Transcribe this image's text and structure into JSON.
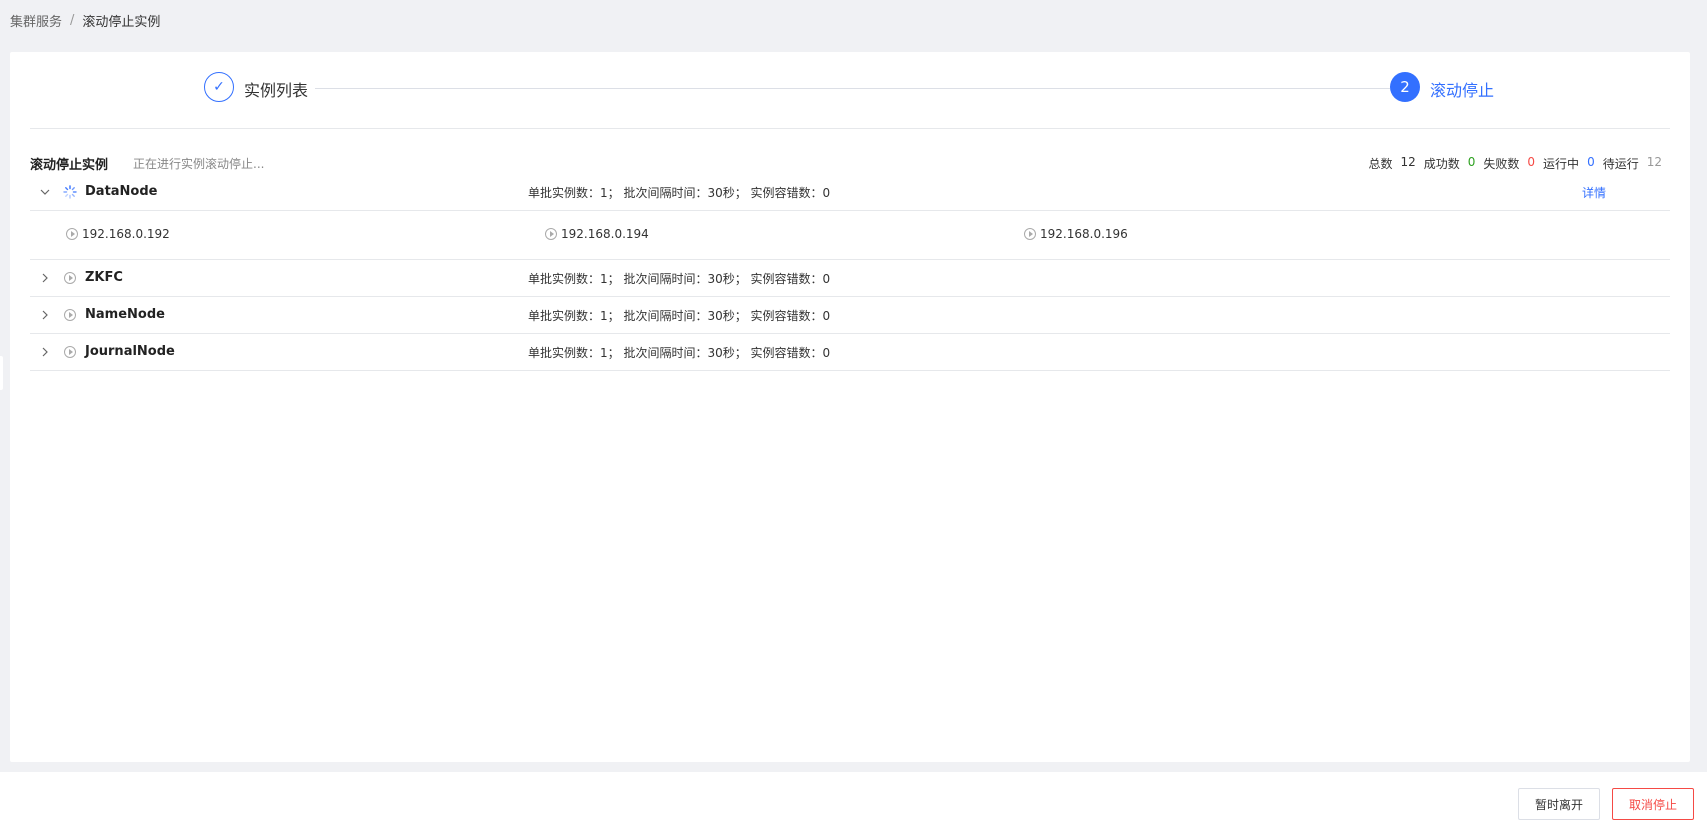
{
  "breadcrumb": {
    "parent": "集群服务",
    "separator": "/",
    "current": "滚动停止实例"
  },
  "steps": [
    {
      "index": "✓",
      "label": "实例列表",
      "state": "done"
    },
    {
      "index": "2",
      "label": "滚动停止",
      "state": "active"
    }
  ],
  "section": {
    "title": "滚动停止实例",
    "subtitle": "正在进行实例滚动停止..."
  },
  "stats": {
    "total_label": "总数",
    "total": "12",
    "success_label": "成功数",
    "success": "0",
    "fail_label": "失败数",
    "fail": "0",
    "running_label": "运行中",
    "running": "0",
    "pending_label": "待运行",
    "pending": "12"
  },
  "groups": [
    {
      "name": "DataNode",
      "meta": "单批实例数：1； 批次间隔时间：30秒； 实例容错数：0",
      "detail": "详情",
      "expanded": true,
      "instances": [
        "192.168.0.192",
        "192.168.0.194",
        "192.168.0.196"
      ]
    },
    {
      "name": "ZKFC",
      "meta": "单批实例数：1； 批次间隔时间：30秒； 实例容错数：0"
    },
    {
      "name": "NameNode",
      "meta": "单批实例数：1； 批次间隔时间：30秒； 实例容错数：0"
    },
    {
      "name": "JournalNode",
      "meta": "单批实例数：1； 批次间隔时间：30秒； 实例容错数：0"
    }
  ],
  "footer": {
    "leave_label": "暂时离开",
    "cancel_label": "取消停止"
  },
  "colors": {
    "primary": "#3370ff",
    "success": "#2ea121",
    "danger": "#f54a45"
  }
}
